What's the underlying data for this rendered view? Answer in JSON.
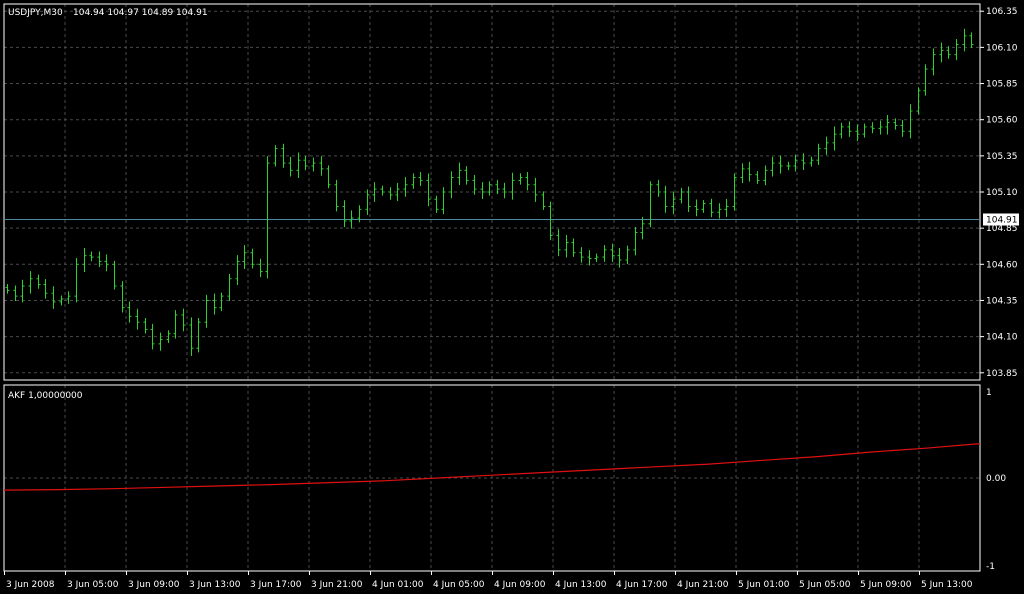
{
  "header": {
    "symbol_timeframe": "USDJPY,M30",
    "ohlc": "104.94 104.97 104.89 104.91"
  },
  "indicator": {
    "label": "AKF 1,00000000"
  },
  "colors": {
    "background": "#000000",
    "grid": "#4a4a4a",
    "bars": "#2fd12f",
    "indicator_line": "#e01010",
    "current_price_line": "#4d8a9c",
    "text": "#ffffff",
    "price_box": "#ffffff"
  },
  "chart_data": [
    {
      "type": "ohlc",
      "title": "USDJPY,M30",
      "current_price": 104.91,
      "ylim": [
        103.8,
        106.4
      ],
      "y_ticks": [
        "106.35",
        "106.10",
        "105.85",
        "105.60",
        "105.35",
        "105.10",
        "104.85",
        "104.60",
        "104.35",
        "104.10",
        "103.85"
      ],
      "x_ticks": [
        "3 Jun 2008",
        "3 Jun 05:00",
        "3 Jun 09:00",
        "3 Jun 13:00",
        "3 Jun 17:00",
        "3 Jun 21:00",
        "4 Jun 01:00",
        "4 Jun 05:00",
        "4 Jun 09:00",
        "4 Jun 13:00",
        "4 Jun 17:00",
        "4 Jun 21:00",
        "5 Jun 01:00",
        "5 Jun 05:00",
        "5 Jun 09:00",
        "5 Jun 13:00"
      ],
      "closes": [
        104.42,
        104.38,
        104.45,
        104.5,
        104.46,
        104.4,
        104.34,
        104.36,
        104.38,
        104.6,
        104.66,
        104.65,
        104.62,
        104.6,
        104.45,
        104.3,
        104.24,
        104.2,
        104.15,
        104.05,
        104.08,
        104.12,
        104.25,
        104.18,
        104.02,
        104.2,
        104.35,
        104.3,
        104.38,
        104.5,
        104.62,
        104.68,
        104.6,
        104.55,
        105.3,
        105.4,
        105.3,
        105.25,
        105.32,
        105.28,
        105.3,
        105.26,
        105.15,
        105.0,
        104.9,
        104.92,
        104.98,
        105.08,
        105.12,
        105.1,
        105.08,
        105.12,
        105.15,
        105.2,
        105.18,
        105.05,
        104.98,
        105.1,
        105.2,
        105.25,
        105.18,
        105.12,
        105.1,
        105.15,
        105.12,
        105.1,
        105.18,
        105.2,
        105.15,
        105.08,
        105.0,
        104.8,
        104.7,
        104.75,
        104.68,
        104.65,
        104.64,
        104.65,
        104.7,
        104.66,
        104.63,
        104.7,
        104.82,
        104.88,
        105.15,
        105.1,
        105.0,
        105.05,
        105.1,
        105.0,
        104.98,
        105.02,
        104.96,
        104.98,
        105.0,
        105.2,
        105.26,
        105.22,
        105.18,
        105.25,
        105.3,
        105.28,
        105.28,
        105.32,
        105.3,
        105.32,
        105.4,
        105.44,
        105.5,
        105.55,
        105.52,
        105.5,
        105.55,
        105.54,
        105.55,
        105.58,
        105.56,
        105.52,
        105.66,
        105.8,
        105.95,
        106.05,
        106.08,
        106.05,
        106.12,
        106.18,
        106.12
      ]
    },
    {
      "type": "line",
      "title": "AKF 1,00000000",
      "ylim": [
        -1,
        1
      ],
      "y_ticks": [
        "1",
        "0.00",
        "-1"
      ],
      "series": [
        {
          "values": [
            -0.13,
            -0.125,
            -0.115,
            -0.1,
            -0.085,
            -0.07,
            -0.05,
            -0.03,
            0.0,
            0.03,
            0.06,
            0.09,
            0.12,
            0.15,
            0.19,
            0.23,
            0.28,
            0.32,
            0.37
          ]
        }
      ]
    }
  ]
}
